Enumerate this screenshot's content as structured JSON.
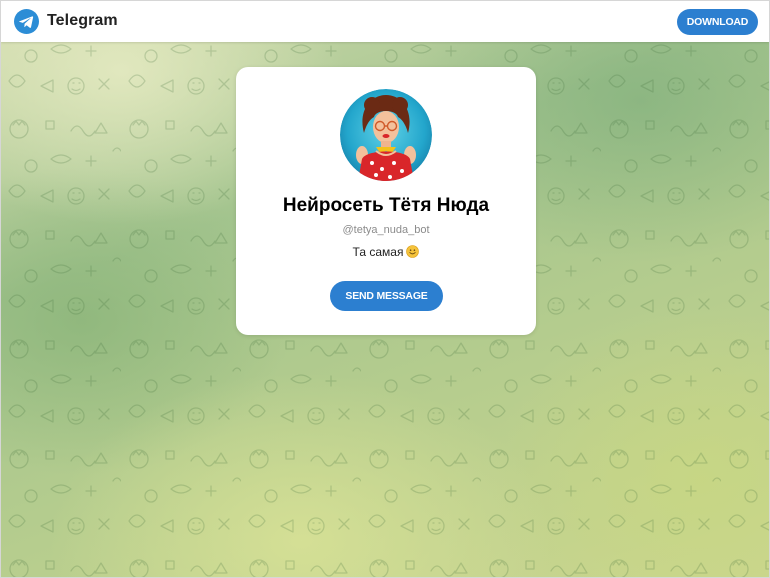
{
  "header": {
    "logo_icon": "telegram-plane-icon",
    "logo_text": "Telegram",
    "download_label": "DOWNLOAD"
  },
  "card": {
    "avatar_icon": "bot-avatar-illustration",
    "name": "Нейросеть Тётя Нюда",
    "username": "@tetya_nuda_bot",
    "description": "Та самая",
    "description_emoji": "smiling-face-icon",
    "button_label": "SEND MESSAGE"
  },
  "colors": {
    "accent": "#2c7fd0",
    "background_green": "#a3c48e",
    "background_yellow": "#cbd68f",
    "card": "#ffffff"
  }
}
